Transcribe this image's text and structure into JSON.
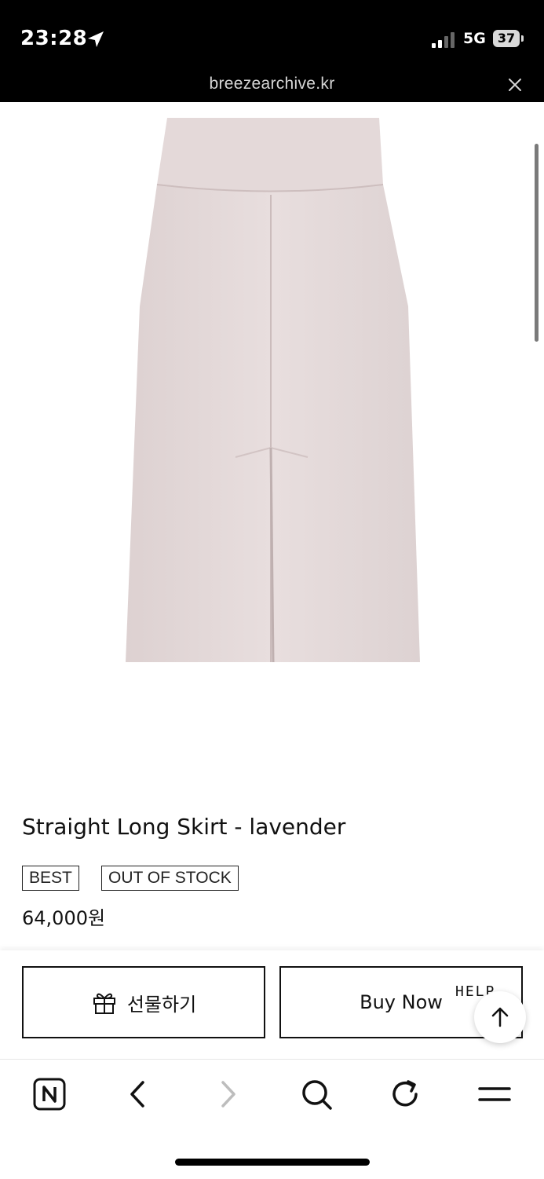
{
  "status_bar": {
    "time": "23:28",
    "network": "5G",
    "battery": "37"
  },
  "browser": {
    "url": "breezearchive.kr"
  },
  "product": {
    "title": "Straight Long Skirt - lavender",
    "badges": [
      "BEST",
      "OUT OF STOCK"
    ],
    "price": "64,000원",
    "image_color": "#e6dcdc"
  },
  "actions": {
    "gift_label": "선물하기",
    "buy_label": "Buy Now",
    "help_label": "HELP"
  },
  "toolbar": {
    "items": [
      "naver-home-icon",
      "back-icon",
      "forward-icon",
      "search-icon",
      "refresh-icon",
      "menu-icon"
    ]
  }
}
